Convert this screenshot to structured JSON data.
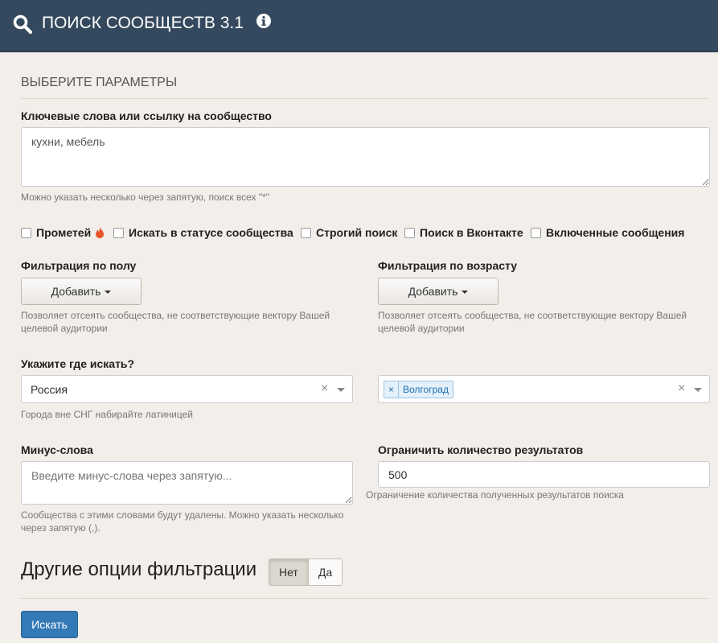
{
  "header": {
    "title": "ПОИСК СООБЩЕСТВ 3.1",
    "search_icon": "search-icon",
    "info_icon": "info-icon"
  },
  "section_title": "ВЫБЕРИТЕ ПАРАМЕТРЫ",
  "keywords": {
    "label": "Ключевые слова или ссылку на сообщество",
    "value": "кухни, мебель",
    "help": "Можно указать несколько через запятую, поиск всех \"*\""
  },
  "checkboxes": [
    {
      "label": "Прометей",
      "checked": false
    },
    {
      "label": "Искать в статусе сообщества",
      "checked": false
    },
    {
      "label": "Строгий поиск",
      "checked": false
    },
    {
      "label": "Поиск в Вконтакте",
      "checked": false
    },
    {
      "label": "Включенные сообщения",
      "checked": false
    }
  ],
  "gender_filter": {
    "label": "Фильтрация по полу",
    "button": "Добавить",
    "help": "Позволяет отсеять сообщества, не соответствующие вектору Вашей целевой аудитории"
  },
  "age_filter": {
    "label": "Фильтрация по возрасту",
    "button": "Добавить",
    "help": "Позволяет отсеять сообщества, не соответствующие вектору Вашей целевой аудитории"
  },
  "location": {
    "label": "Укажите где искать?",
    "country": "Россия",
    "city_tag": "Волгоград",
    "clear_symbol": "×",
    "help": "Города вне СНГ набирайте латиницей"
  },
  "minus_words": {
    "label": "Минус-слова",
    "placeholder": "Введите минус-слова через запятую...",
    "help": "Сообщества с этими словами будут удалены. Можно указать несколько через запятую (,)."
  },
  "limit": {
    "label": "Ограничить количество результатов",
    "value": "500",
    "help": "Ограничение количества полученных результатов поиска"
  },
  "other_options": {
    "label": "Другие опции фильтрации",
    "no": "Нет",
    "yes": "Да"
  },
  "search_button": "Искать",
  "colors": {
    "header_bg": "#34495e",
    "page_bg": "#f2eee9",
    "primary": "#337ab7",
    "flame": "#e8552b"
  }
}
